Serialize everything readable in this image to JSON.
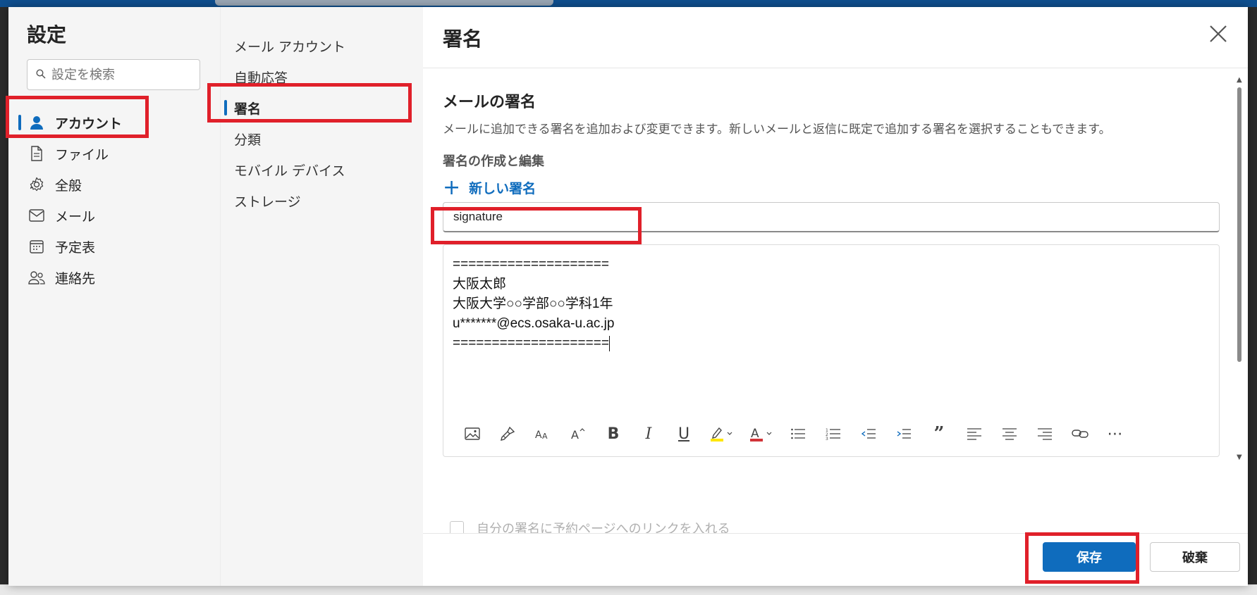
{
  "dialog": {
    "title": "設定",
    "search_placeholder": "設定を検索",
    "close_icon": "close-icon"
  },
  "nav_primary": [
    {
      "label": "アカウント",
      "icon": "person-icon",
      "active": true
    },
    {
      "label": "ファイル",
      "icon": "file-icon",
      "active": false
    },
    {
      "label": "全般",
      "icon": "gear-icon",
      "active": false
    },
    {
      "label": "メール",
      "icon": "mail-icon",
      "active": false
    },
    {
      "label": "予定表",
      "icon": "calendar-icon",
      "active": false
    },
    {
      "label": "連絡先",
      "icon": "people-icon",
      "active": false
    }
  ],
  "nav_secondary": [
    {
      "label": "メール アカウント",
      "active": false
    },
    {
      "label": "自動応答",
      "active": false
    },
    {
      "label": "署名",
      "active": true
    },
    {
      "label": "分類",
      "active": false
    },
    {
      "label": "モバイル デバイス",
      "active": false
    },
    {
      "label": "ストレージ",
      "active": false
    }
  ],
  "main": {
    "title": "署名",
    "section_title": "メールの署名",
    "section_desc": "メールに追加できる署名を追加および変更できます。新しいメールと返信に既定で追加する署名を選択することもできます。",
    "subsection_title": "署名の作成と編集",
    "new_signature_label": "新しい署名",
    "signature_name": "signature",
    "signature_body": [
      "====================",
      "大阪太郎",
      "大阪大学○○学部○○学科1年",
      "u*******@ecs.osaka-u.ac.jp",
      "===================="
    ],
    "checkbox_label": "自分の署名に予約ページへのリンクを入れる",
    "save_label": "保存",
    "discard_label": "破棄"
  },
  "colors": {
    "accent": "#0f6cbd",
    "annotation": "#e0202a",
    "highlight_yellow": "#ffe600",
    "font_red": "#d13438"
  }
}
